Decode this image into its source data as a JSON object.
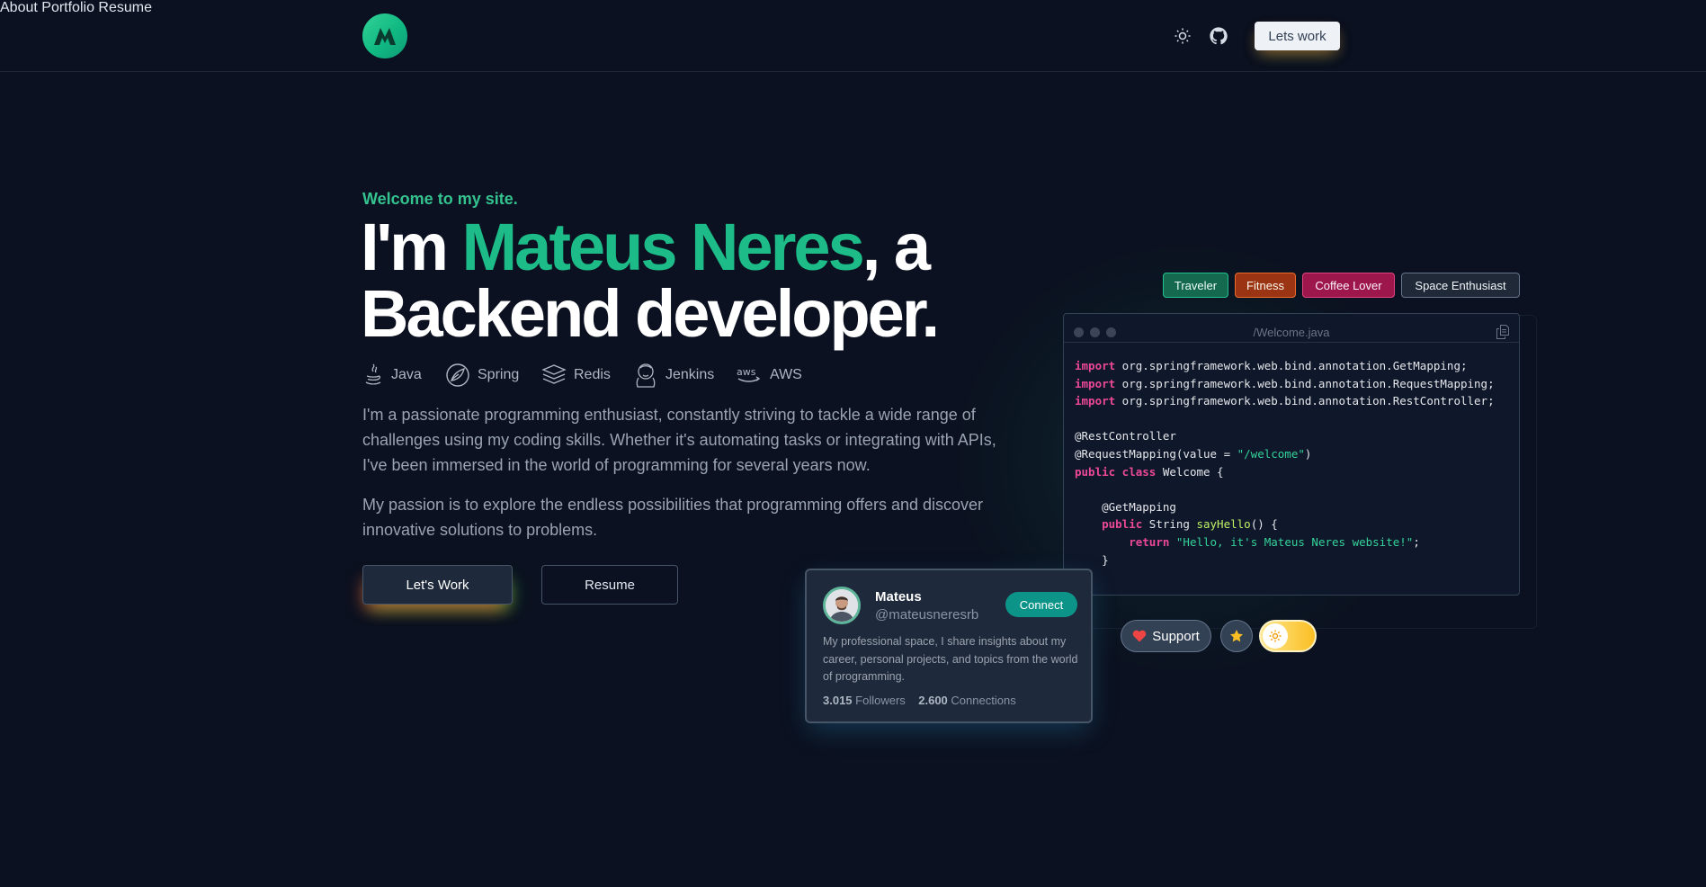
{
  "header": {
    "nav": [
      "About",
      "Portfolio",
      "Resume"
    ],
    "cta_label": "Lets work"
  },
  "hero": {
    "welcome": "Welcome to my site.",
    "headline_prefix": "I'm ",
    "name": "Mateus Neres",
    "headline_suffix": ", a",
    "headline_line2": "Backend developer.",
    "stack": [
      "Java",
      "Spring",
      "Redis",
      "Jenkins",
      "AWS"
    ],
    "bio1": "I'm a passionate programming enthusiast, constantly striving to tackle a wide range of challenges using my coding skills. Whether it's automating tasks or integrating with APIs, I've been immersed in the world of programming for several years now.",
    "bio2": "My passion is to explore the endless possibilities that programming offers and discover innovative solutions to problems.",
    "lets_work_label": "Let's Work",
    "resume_label": "Resume"
  },
  "tags": [
    "Traveler",
    "Fitness",
    "Coffee Lover",
    "Space Enthusiast"
  ],
  "code_window": {
    "title": "/Welcome.java"
  },
  "support": {
    "label": "Support"
  },
  "profile_card": {
    "name": "Mateus",
    "handle": "@mateusneresrb",
    "connect_label": "Connect",
    "description": "My professional space, I share insights about my career, personal projects, and topics from the world of programming.",
    "followers_count": "3.015",
    "followers_label": "Followers",
    "connections_count": "2.600",
    "connections_label": "Connections"
  },
  "colors": {
    "background": "#0b1120",
    "accent": "#1dbb87",
    "tag_traveler": "#16a37a",
    "tag_fitness": "#c2410c",
    "tag_coffee": "#be185d",
    "tag_space": "#475569"
  }
}
